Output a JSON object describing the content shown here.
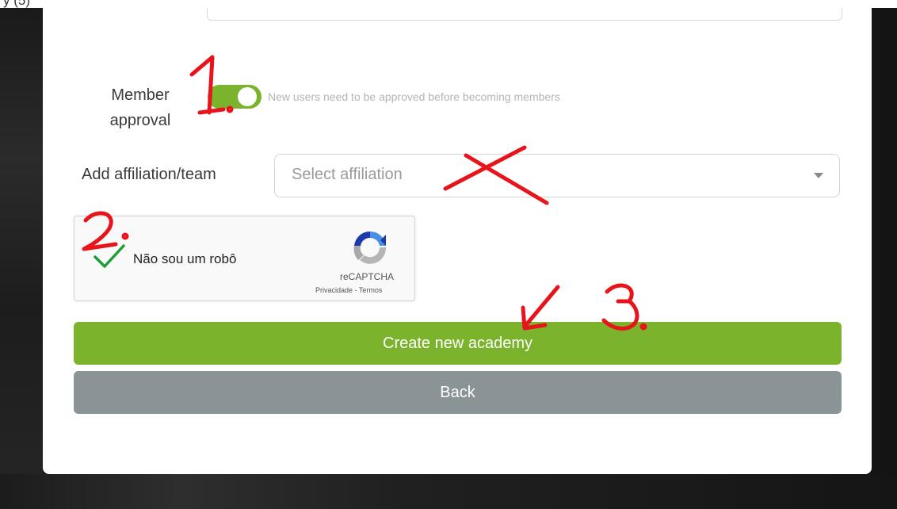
{
  "top_strip": {
    "text": "y (5)"
  },
  "member_approval": {
    "label": "Member approval",
    "toggle_on": true,
    "hint": "New users need to be approved before becoming members"
  },
  "affiliation": {
    "label": "Add affiliation/team",
    "placeholder": "Select affiliation"
  },
  "recaptcha": {
    "checked": true,
    "label": "Não sou um robô",
    "brand": "reCAPTCHA",
    "links": "Privacidade - Termos"
  },
  "buttons": {
    "create": "Create new academy",
    "back": "Back"
  },
  "annotations": {
    "step1": "1.",
    "step2": "2.",
    "step3": "3."
  },
  "colors": {
    "accent_green": "#7cb32d",
    "back_gray": "#8a9496",
    "annotation_red": "#e8141b",
    "check_green": "#1e9e3a"
  }
}
